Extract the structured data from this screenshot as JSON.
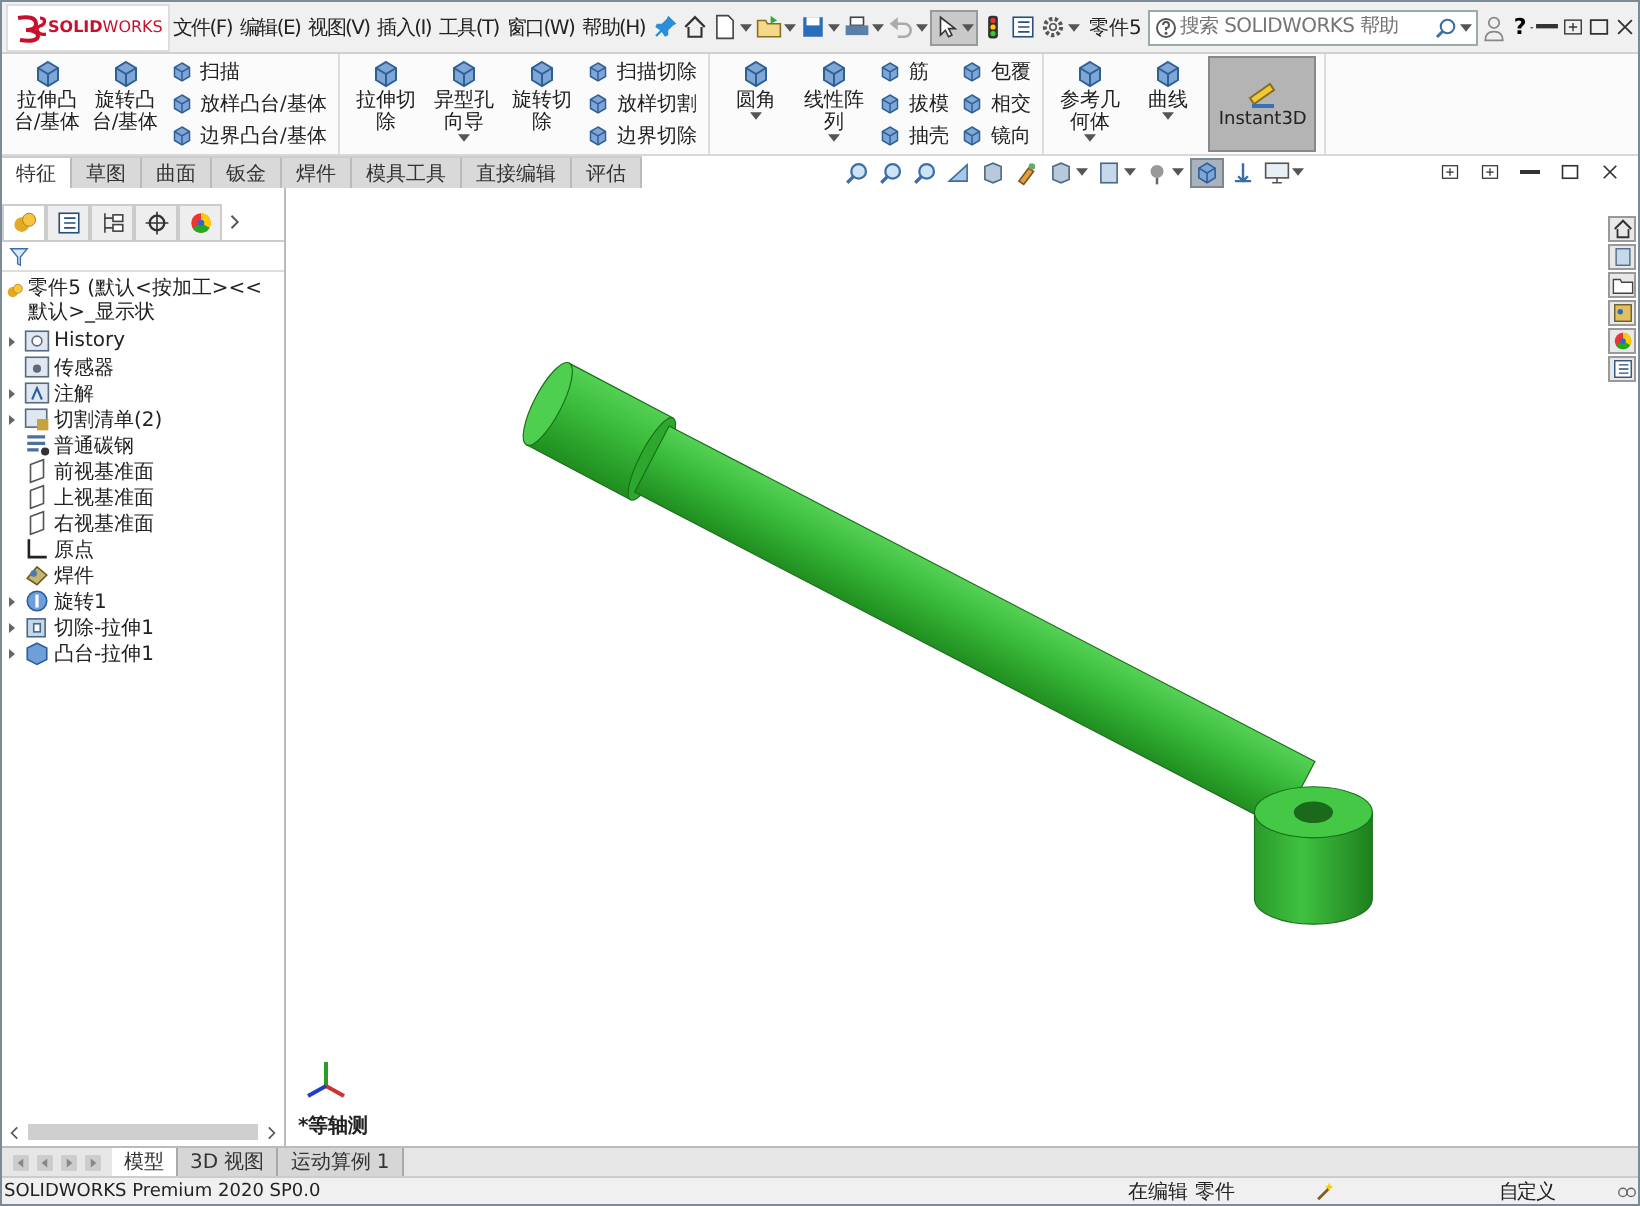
{
  "window": {
    "logo": "**SOLID**WORKS",
    "document": "零件5",
    "search_placeholder": "搜索 SOLIDWORKS 帮助",
    "help_button": "?"
  },
  "menu": [
    "文件(F)",
    "编辑(E)",
    "视图(V)",
    "插入(I)",
    "工具(T)",
    "窗口(W)",
    "帮助(H)"
  ],
  "quick_toolbar": [
    {
      "kind": "home",
      "selected": false,
      "has_menu": false
    },
    {
      "kind": "new",
      "selected": false,
      "has_menu": true
    },
    {
      "kind": "open",
      "selected": false,
      "has_menu": true
    },
    {
      "kind": "save",
      "selected": false,
      "has_menu": true
    },
    {
      "kind": "print",
      "selected": false,
      "has_menu": true
    },
    {
      "kind": "undo",
      "selected": false,
      "has_menu": true
    },
    {
      "kind": "pointer",
      "selected": true,
      "has_menu": true
    },
    {
      "kind": "traffic",
      "selected": false,
      "has_menu": false
    },
    {
      "kind": "list",
      "selected": false,
      "has_menu": false
    },
    {
      "kind": "gear",
      "selected": false,
      "has_menu": true
    }
  ],
  "ribbon": [
    {
      "items": [
        {
          "kind": "large",
          "label": "拉伸凸台/基体",
          "has_menu": false
        },
        {
          "kind": "large",
          "label": "旋转凸台/基体",
          "has_menu": false
        },
        {
          "kind": "stack",
          "items": [
            "扫描",
            "放样凸台/基体",
            "边界凸台/基体"
          ]
        }
      ]
    },
    {
      "items": [
        {
          "kind": "large",
          "label": "拉伸切除",
          "has_menu": false
        },
        {
          "kind": "large",
          "label": "异型孔向导",
          "has_menu": true
        },
        {
          "kind": "large",
          "label": "旋转切除",
          "has_menu": false
        },
        {
          "kind": "stack",
          "items": [
            "扫描切除",
            "放样切割",
            "边界切除"
          ]
        }
      ]
    },
    {
      "items": [
        {
          "kind": "large",
          "label": "圆角",
          "has_menu": true
        },
        {
          "kind": "large",
          "label": "线性阵列",
          "has_menu": true
        },
        {
          "kind": "stack",
          "items": [
            "筋",
            "拔模",
            "抽壳"
          ]
        },
        {
          "kind": "stack",
          "items": [
            "包覆",
            "相交",
            "镜向"
          ]
        }
      ]
    },
    {
      "items": [
        {
          "kind": "large",
          "label": "参考几何体",
          "has_menu": true
        },
        {
          "kind": "large",
          "label": "曲线",
          "has_menu": true
        },
        {
          "kind": "toggle",
          "label": "Instant3D",
          "selected": true
        }
      ]
    }
  ],
  "tabs": [
    {
      "label": "特征",
      "selected": true
    },
    {
      "label": "草图",
      "selected": false
    },
    {
      "label": "曲面",
      "selected": false
    },
    {
      "label": "钣金",
      "selected": false
    },
    {
      "label": "焊件",
      "selected": false
    },
    {
      "label": "模具工具",
      "selected": false
    },
    {
      "label": "直接编辑",
      "selected": false
    },
    {
      "label": "评估",
      "selected": false
    }
  ],
  "view_toolbar": [
    {
      "kind": "magnifier",
      "selected": false,
      "has_menu": false
    },
    {
      "kind": "magnifier",
      "selected": false,
      "has_menu": false
    },
    {
      "kind": "magnifier",
      "selected": false,
      "has_menu": false
    },
    {
      "kind": "wedge",
      "selected": false,
      "has_menu": false
    },
    {
      "kind": "block",
      "selected": false,
      "has_menu": false
    },
    {
      "kind": "brush",
      "selected": false,
      "has_menu": false
    },
    {
      "kind": "block",
      "selected": false,
      "has_menu": true
    },
    {
      "kind": "box",
      "selected": false,
      "has_menu": true
    },
    {
      "kind": "lamp",
      "selected": false,
      "has_menu": true
    },
    {
      "kind": "cube",
      "selected": true,
      "has_menu": false
    },
    {
      "kind": "anchor",
      "selected": false,
      "has_menu": false
    },
    {
      "kind": "monitor",
      "selected": false,
      "has_menu": true
    }
  ],
  "panel_tabs": [
    {
      "kind": "part",
      "selected": true
    },
    {
      "kind": "list",
      "selected": false
    },
    {
      "kind": "tree",
      "selected": false
    },
    {
      "kind": "crosshair",
      "selected": false
    },
    {
      "kind": "wheel",
      "selected": false
    }
  ],
  "tree": {
    "root": "零件5 (默认<按加工><<默认>_显示状",
    "items": [
      {
        "label": "History",
        "kind": "history",
        "collapsed": true
      },
      {
        "label": "传感器",
        "kind": "sensor",
        "collapsed": false
      },
      {
        "label": "注解",
        "kind": "annotation",
        "collapsed": true
      },
      {
        "label": "切割清单(2)",
        "kind": "cutlist",
        "collapsed": true
      },
      {
        "label": "普通碳钢",
        "kind": "material",
        "collapsed": false
      },
      {
        "label": "前视基准面",
        "kind": "plane",
        "collapsed": false
      },
      {
        "label": "上视基准面",
        "kind": "plane",
        "collapsed": false
      },
      {
        "label": "右视基准面",
        "kind": "plane",
        "collapsed": false
      },
      {
        "label": "原点",
        "kind": "origin",
        "collapsed": false
      },
      {
        "label": "焊件",
        "kind": "weldment",
        "collapsed": false
      },
      {
        "label": "旋转1",
        "kind": "revolve",
        "collapsed": true
      },
      {
        "label": "切除-拉伸1",
        "kind": "cut",
        "collapsed": true
      },
      {
        "label": "凸台-拉伸1",
        "kind": "boss",
        "collapsed": true
      }
    ]
  },
  "viewport": {
    "view_name": "*等轴测"
  },
  "bottom_tabs": [
    {
      "label": "模型",
      "selected": true
    },
    {
      "label": "3D 视图",
      "selected": false
    },
    {
      "label": "运动算例 1",
      "selected": false
    }
  ],
  "status_bar": {
    "product": "SOLIDWORKS Premium 2020 SP0.0",
    "mode": "在编辑 零件",
    "units": "自定义"
  }
}
